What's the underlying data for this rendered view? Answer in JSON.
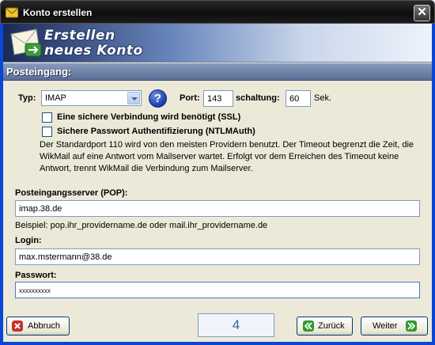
{
  "window": {
    "title": "Konto erstellen",
    "close_glyph": "✕"
  },
  "banner": {
    "line1": "Erstellen",
    "line2": "neues Konto"
  },
  "section": {
    "title": "Posteingang:"
  },
  "form": {
    "typ_label": "Typ:",
    "typ_value": "IMAP",
    "help_glyph": "?",
    "port_label": "Port:",
    "port_value": "143",
    "schaltung_label": "schaltung:",
    "schaltung_value": "60",
    "sek_label": "Sek.",
    "ssl_label": "Eine sichere Verbindung wird benötigt (SSL)",
    "ssl_checked": false,
    "ntlm_label": "Sichere Passwort Authentifizierung (NTLMAuth)",
    "ntlm_checked": false,
    "info_text": "Der Standardport 110 wird von den meisten Providern benutzt. Der Timeout  begrenzt die Zeit, die WikMail auf eine Antwort vom Mailserver wartet. Erfolgt vor dem Erreichen des Timeout keine Antwort, trennt WikMail die Verbindung zum Mailserver.",
    "server_label": "Posteingangsserver (POP):",
    "server_value": "imap.38.de",
    "example_text": "Beispiel: pop.ihr_providername.de oder mail.ihr_providername.de",
    "login_label": "Login:",
    "login_value": "max.mstermann@38.de",
    "password_label": "Passwort:",
    "password_value": "xxxxxxxxxx"
  },
  "footer": {
    "cancel_label": "Abbruch",
    "page_number": "4",
    "back_label": "Zurück",
    "next_label": "Weiter"
  },
  "colors": {
    "accent_green": "#2e9a2e",
    "accent_red": "#c8312b",
    "titlebar": "#111111",
    "dialog_bg": "#ece9d8"
  },
  "icons": {
    "app": "mail-app-icon",
    "banner": "mail-envelope-icon",
    "help": "help-icon",
    "cancel": "cancel-x-icon",
    "back": "double-left-arrow-icon",
    "next": "double-right-arrow-icon"
  }
}
